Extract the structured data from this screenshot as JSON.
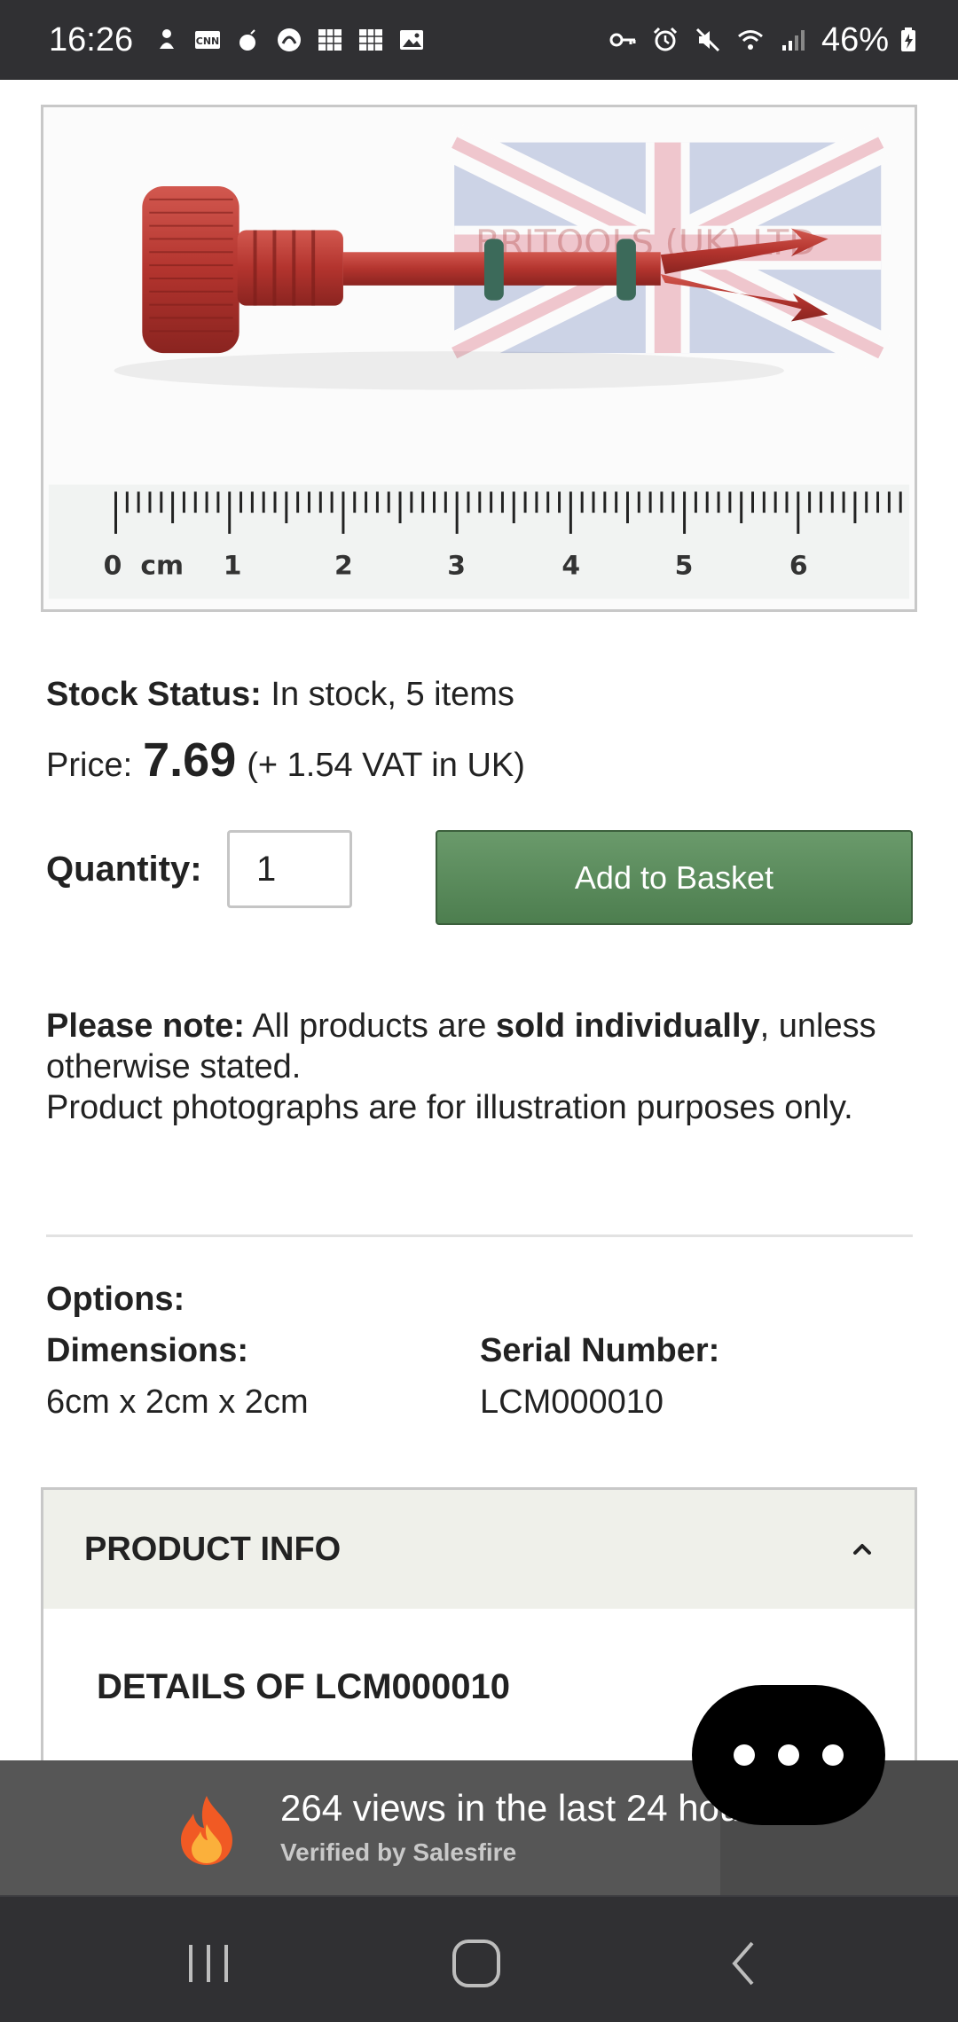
{
  "status_bar": {
    "time": "16:26",
    "battery": "46%",
    "left_icons": [
      "person-icon",
      "cnn-icon",
      "bomb-icon",
      "app-icon",
      "grid-icon",
      "grid-icon",
      "image-icon"
    ],
    "right_icons": [
      "key-icon",
      "alarm-icon",
      "mute-icon",
      "wifi-icon",
      "signal-icon",
      "battery-icon"
    ]
  },
  "product": {
    "image_watermark": "BRITOOLS (UK) LTD",
    "ruler_labels": [
      "0",
      "cm",
      "1",
      "2",
      "3",
      "4",
      "5",
      "6"
    ],
    "stock_label": "Stock Status:",
    "stock_value": "In stock, 5 items",
    "price_label": "Price:",
    "price_value": "7.69",
    "price_vat": "(+ 1.54 VAT in UK)",
    "quantity_label": "Quantity:",
    "quantity_value": "1",
    "add_button": "Add to Basket"
  },
  "note": {
    "please_note": "Please note:",
    "text1": " All products are ",
    "sold_individually": "sold individually",
    "text2": ", unless otherwise stated.",
    "line2": "Product photographs are for illustration purposes only."
  },
  "options": {
    "title": "Options:",
    "dimensions_label": "Dimensions:",
    "dimensions_value": "6cm x 2cm x 2cm",
    "serial_label": "Serial Number:",
    "serial_value": "LCM000010"
  },
  "product_info": {
    "title": "PRODUCT INFO",
    "details_title": "DETAILS OF LCM000010"
  },
  "salesfire": {
    "views": "264 views in the last 24 hou",
    "verified": "Verified by Salesfire"
  },
  "colors": {
    "button_green": "#5a8a5c",
    "status_bar": "#303033",
    "accordion_bg": "#eff0ea"
  }
}
